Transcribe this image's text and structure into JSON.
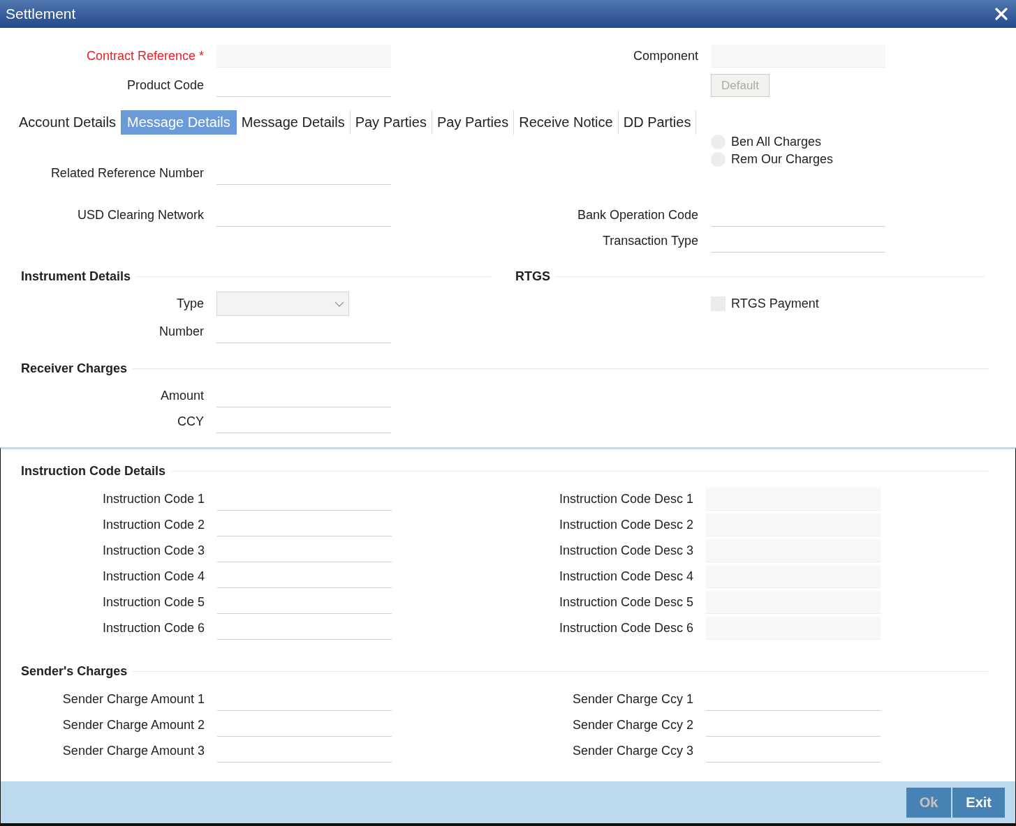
{
  "window": {
    "title": "Settlement"
  },
  "header": [
    {
      "left": {
        "kind": "readonly",
        "label": "Contract Reference",
        "required_mark": "*"
      },
      "right": {
        "kind": "readonly",
        "label": "Component"
      }
    },
    {
      "left": {
        "kind": "input",
        "label": "Product Code"
      },
      "right": {
        "kind": "button",
        "label": "Default",
        "disabled": true
      }
    }
  ],
  "tabs": [
    {
      "label": "Account Details",
      "selected": false
    },
    {
      "label": "Message Details",
      "selected": true
    },
    {
      "label": "Message Details",
      "selected": false
    },
    {
      "label": "Pay Parties",
      "selected": false
    },
    {
      "label": "Pay Parties",
      "selected": false
    },
    {
      "label": "Receive Notice",
      "selected": false
    },
    {
      "label": "DD Parties",
      "selected": false
    }
  ],
  "main": [
    {
      "left": {
        "kind": "input",
        "label": "Related Reference Number"
      },
      "right": {
        "kind": "radios",
        "options": [
          {
            "label": "Ben All Charges",
            "selected": false
          },
          {
            "label": "Rem Our Charges",
            "selected": false
          }
        ]
      }
    },
    {
      "left": {
        "kind": "input",
        "label": "USD Clearing Network"
      },
      "right": {
        "kind": "input",
        "label": "Bank Operation Code"
      }
    },
    {
      "right": {
        "kind": "input",
        "label": "Transaction Type"
      }
    }
  ],
  "split_sections": [
    {
      "title": "Instrument Details",
      "fields": [
        {
          "kind": "select",
          "label": "Type"
        },
        {
          "kind": "input",
          "label": "Number"
        }
      ]
    },
    {
      "title": "RTGS",
      "fields": [
        {
          "kind": "checkbox",
          "label": "RTGS Payment",
          "checked": false
        }
      ]
    }
  ],
  "receiver_charges": {
    "title": "Receiver Charges",
    "fields": [
      {
        "kind": "input",
        "label": "Amount"
      },
      {
        "kind": "input",
        "label": "CCY"
      }
    ]
  },
  "panel_sections": [
    {
      "title": "Instruction Code Details",
      "rows": [
        {
          "left": {
            "kind": "input",
            "label": "Instruction Code 1"
          },
          "right": {
            "kind": "readonly",
            "label": "Instruction Code Desc 1"
          }
        },
        {
          "left": {
            "kind": "input",
            "label": "Instruction Code 2"
          },
          "right": {
            "kind": "readonly",
            "label": "Instruction Code Desc 2"
          }
        },
        {
          "left": {
            "kind": "input",
            "label": "Instruction Code 3"
          },
          "right": {
            "kind": "readonly",
            "label": "Instruction Code Desc 3"
          }
        },
        {
          "left": {
            "kind": "input",
            "label": "Instruction Code 4"
          },
          "right": {
            "kind": "readonly",
            "label": "Instruction Code Desc 4"
          }
        },
        {
          "left": {
            "kind": "input",
            "label": "Instruction Code 5"
          },
          "right": {
            "kind": "readonly",
            "label": "Instruction Code Desc 5"
          }
        },
        {
          "left": {
            "kind": "input",
            "label": "Instruction Code 6"
          },
          "right": {
            "kind": "readonly",
            "label": "Instruction Code Desc 6"
          }
        }
      ]
    },
    {
      "title": "Sender's Charges",
      "rows": [
        {
          "left": {
            "kind": "input",
            "label": "Sender Charge Amount 1"
          },
          "right": {
            "kind": "input",
            "label": "Sender Charge Ccy 1"
          }
        },
        {
          "left": {
            "kind": "input",
            "label": "Sender Charge Amount 2"
          },
          "right": {
            "kind": "input",
            "label": "Sender Charge Ccy 2"
          }
        },
        {
          "left": {
            "kind": "input",
            "label": "Sender Charge Amount 3"
          },
          "right": {
            "kind": "input",
            "label": "Sender Charge Ccy 3"
          }
        }
      ]
    }
  ],
  "footer": {
    "buttons": [
      {
        "label": "Ok",
        "disabled": true
      },
      {
        "label": "Exit",
        "disabled": false
      }
    ]
  }
}
